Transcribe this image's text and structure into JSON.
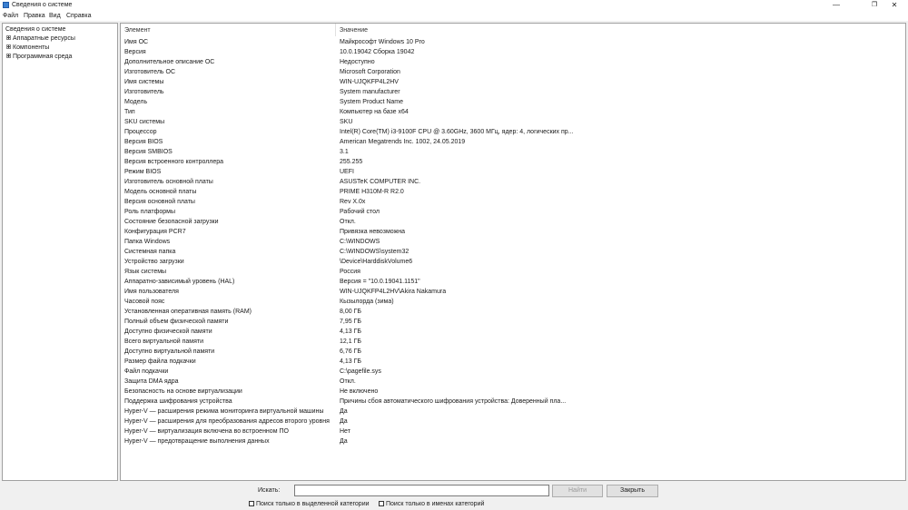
{
  "window": {
    "title": "Сведения о системе",
    "min_glyph": "—",
    "max_glyph": "❐",
    "close_glyph": "✕"
  },
  "menu": [
    "Файл",
    "Правка",
    "Вид",
    "Справка"
  ],
  "tree": {
    "root": "Сведения о системе",
    "nodes": [
      "Аппаратные ресурсы",
      "Компоненты",
      "Программная среда"
    ]
  },
  "table": {
    "columns": [
      "Элемент",
      "Значение"
    ],
    "rows": [
      {
        "name": "Имя ОС",
        "value": "Майкрософт Windows 10 Pro"
      },
      {
        "name": "Версия",
        "value": "10.0.19042 Сборка 19042"
      },
      {
        "name": "Дополнительное описание ОС",
        "value": "Недоступно"
      },
      {
        "name": "Изготовитель ОС",
        "value": "Microsoft Corporation"
      },
      {
        "name": "Имя системы",
        "value": "WIN-UJQKFP4L2HV"
      },
      {
        "name": "Изготовитель",
        "value": "System manufacturer"
      },
      {
        "name": "Модель",
        "value": "System Product Name"
      },
      {
        "name": "Тип",
        "value": "Компьютер на базе x64"
      },
      {
        "name": "SKU системы",
        "value": "SKU"
      },
      {
        "name": "Процессор",
        "value": "Intel(R) Core(TM) i3-9100F CPU @ 3.60GHz, 3600 МГц, ядер: 4, логических пр..."
      },
      {
        "name": "Версия BIOS",
        "value": "American Megatrends Inc. 1002, 24.05.2019"
      },
      {
        "name": "Версия SMBIOS",
        "value": "3.1"
      },
      {
        "name": "Версия встроенного контроллера",
        "value": "255.255"
      },
      {
        "name": "Режим BIOS",
        "value": "UEFI"
      },
      {
        "name": "Изготовитель основной платы",
        "value": "ASUSTeK COMPUTER INC."
      },
      {
        "name": "Модель основной платы",
        "value": "PRIME H310M-R R2.0"
      },
      {
        "name": "Версия основной платы",
        "value": "Rev X.0x"
      },
      {
        "name": "Роль платформы",
        "value": "Рабочий стол"
      },
      {
        "name": "Состояние безопасной загрузки",
        "value": "Откл."
      },
      {
        "name": "Конфигурация PCR7",
        "value": "Привязка невозможна"
      },
      {
        "name": "Папка Windows",
        "value": "C:\\WINDOWS"
      },
      {
        "name": "Системная папка",
        "value": "C:\\WINDOWS\\system32"
      },
      {
        "name": "Устройство загрузки",
        "value": "\\Device\\HarddiskVolume6"
      },
      {
        "name": "Язык системы",
        "value": "Россия"
      },
      {
        "name": "Аппаратно-зависимый уровень (HAL)",
        "value": "Версия = \"10.0.19041.1151\""
      },
      {
        "name": "Имя пользователя",
        "value": "WIN-UJQKFP4L2HV\\Akira Nakamura"
      },
      {
        "name": "Часовой пояс",
        "value": "Кызылорда (зима)"
      },
      {
        "name": "Установленная оперативная память (RAM)",
        "value": "8,00 ГБ"
      },
      {
        "name": "Полный объем физической памяти",
        "value": "7,95 ГБ"
      },
      {
        "name": "Доступно физической памяти",
        "value": "4,13 ГБ"
      },
      {
        "name": "Всего виртуальной памяти",
        "value": "12,1 ГБ"
      },
      {
        "name": "Доступно виртуальной памяти",
        "value": "6,76 ГБ"
      },
      {
        "name": "Размер файла подкачки",
        "value": "4,13 ГБ"
      },
      {
        "name": "Файл подкачки",
        "value": "C:\\pagefile.sys"
      },
      {
        "name": "Защита DMA ядра",
        "value": "Откл."
      },
      {
        "name": "Безопасность на основе виртуализации",
        "value": "Не включено"
      },
      {
        "name": "Поддержка шифрования устройства",
        "value": "Причины сбоя автоматического шифрования устройства: Доверенный пла..."
      },
      {
        "name": "Hyper-V — расширения режима мониторинга виртуальной машины",
        "value": "Да"
      },
      {
        "name": "Hyper-V — расширения для преобразования адресов второго уровня",
        "value": "Да"
      },
      {
        "name": "Hyper-V — виртуализация включена во встроенном ПО",
        "value": "Нет"
      },
      {
        "name": "Hyper-V — предотвращение выполнения данных",
        "value": "Да"
      }
    ]
  },
  "search": {
    "label": "Искать:",
    "value": "",
    "find_label": "Найти",
    "close_label": "Закрыть",
    "check_selected_label": "Поиск только в выделенной категории",
    "check_names_label": "Поиск только в именах категорий"
  }
}
